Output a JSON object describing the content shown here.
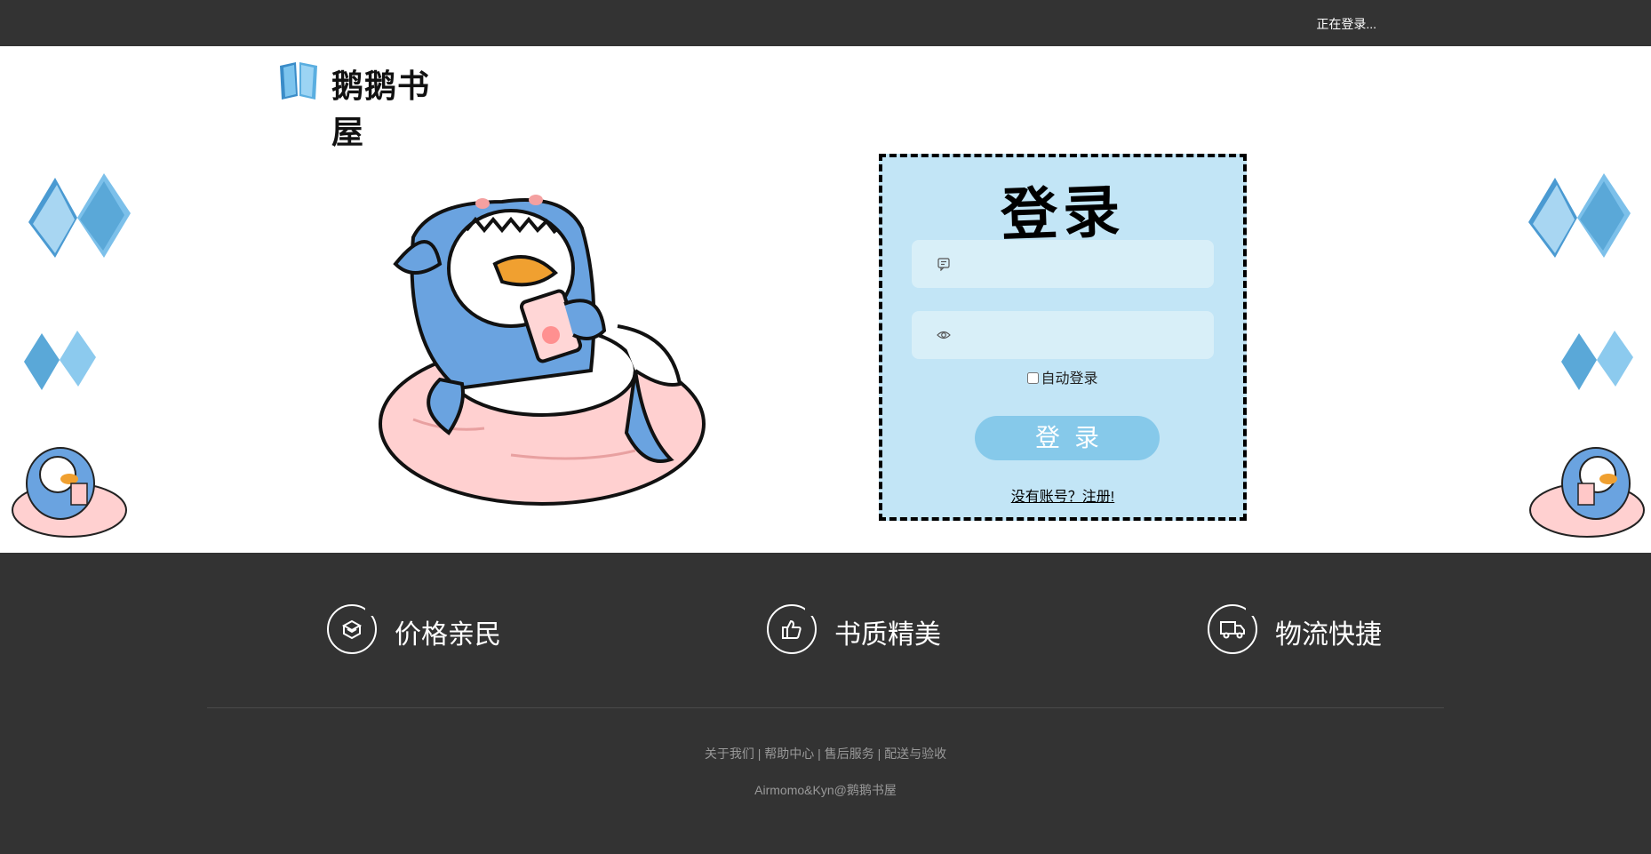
{
  "topbar": {
    "status_text": "正在登录..."
  },
  "logo": {
    "text": "鹅鹅书屋"
  },
  "login": {
    "title": "登录",
    "username_placeholder": "",
    "password_placeholder": "",
    "auto_login_label": "自动登录",
    "auto_login_checked": false,
    "submit_label": "登录",
    "register_link": "没有账号？注册!"
  },
  "features": [
    {
      "icon": "box-icon",
      "label": "价格亲民"
    },
    {
      "icon": "thumbs-up-icon",
      "label": "书质精美"
    },
    {
      "icon": "truck-icon",
      "label": "物流快捷"
    }
  ],
  "footer": {
    "links": [
      "关于我们",
      "帮助中心",
      "售后服务",
      "配送与验收"
    ],
    "separator": " | ",
    "copyright": "Airmomo&Kyn@鹅鹅书屋"
  },
  "colors": {
    "dark_bar": "#333333",
    "login_bg": "#c2e5f6",
    "field_bg": "#d8eff8",
    "button_bg": "#86c9ea",
    "book_blue": "#5aa8d8",
    "shark_blue": "#6aa3e0",
    "float_pink": "#ffd0d0"
  }
}
